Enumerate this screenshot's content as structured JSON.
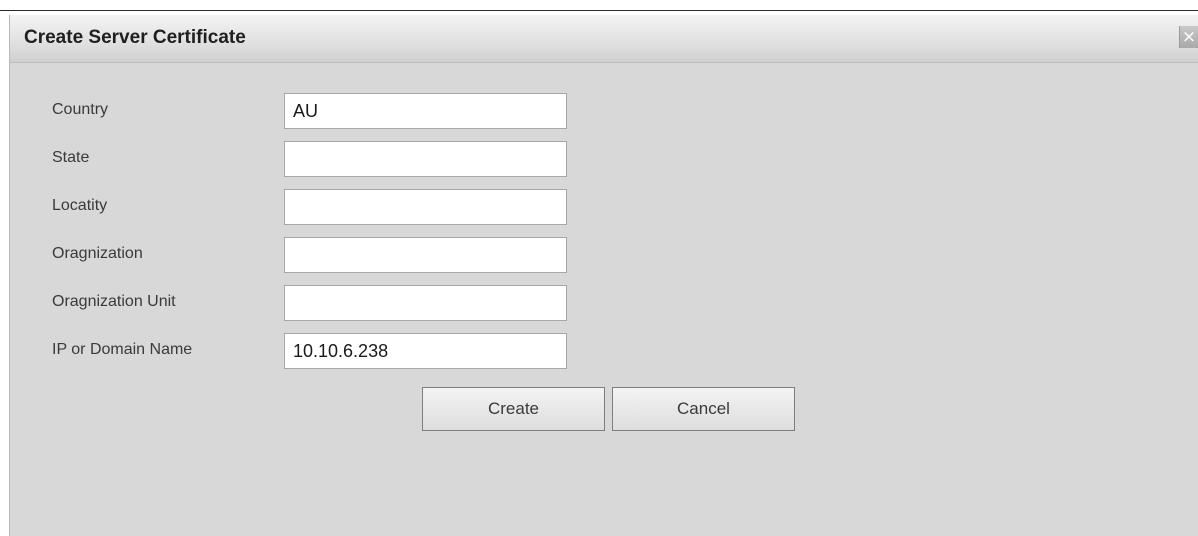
{
  "dialog": {
    "title": "Create Server Certificate",
    "close_icon": "close-icon"
  },
  "form": {
    "fields": [
      {
        "label": "Country",
        "value": "AU",
        "placeholder": ""
      },
      {
        "label": "State",
        "value": "",
        "placeholder": ""
      },
      {
        "label": "Locatity",
        "value": "",
        "placeholder": ""
      },
      {
        "label": "Oragnization",
        "value": "",
        "placeholder": ""
      },
      {
        "label": "Oragnization Unit",
        "value": "",
        "placeholder": ""
      },
      {
        "label": "IP or Domain Name",
        "value": "10.10.6.238",
        "placeholder": ""
      }
    ]
  },
  "buttons": {
    "create_label": "Create",
    "cancel_label": "Cancel"
  },
  "colors": {
    "dialog_background": "#d8d8d8",
    "field_background": "#ffffff",
    "title_text": "#1f1f1f"
  }
}
